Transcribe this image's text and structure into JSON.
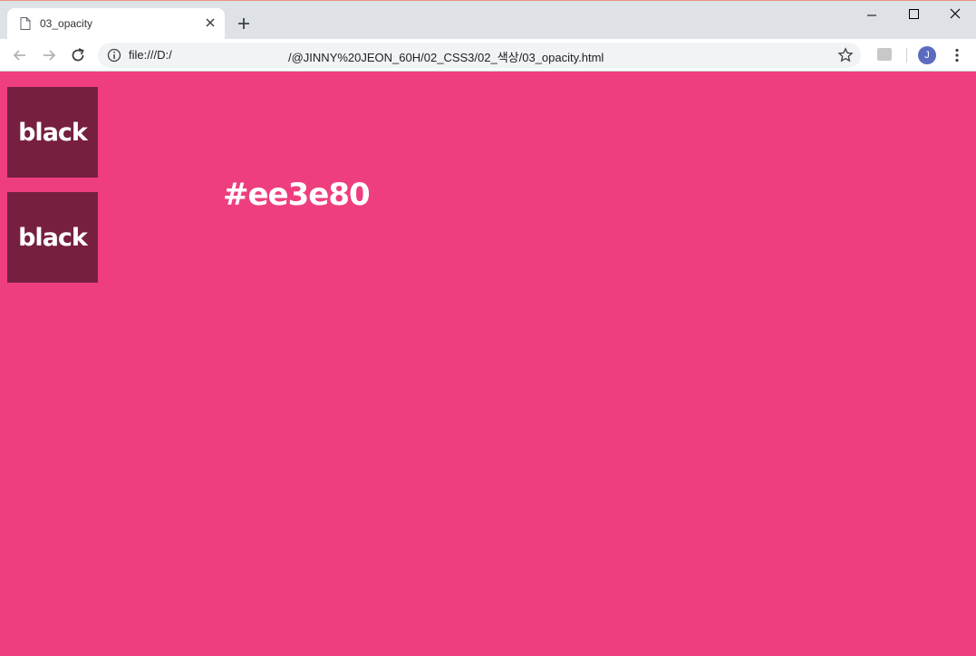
{
  "browser": {
    "tab_title": "03_opacity",
    "url_part1": "file:///D:/",
    "url_part2": "/@JINNY%20JEON_60H/02_CSS3/02_색상/03_opacity.html",
    "profile_initial": "J",
    "extension_label": "ext"
  },
  "page": {
    "background_color": "#ee3e80",
    "boxes": [
      {
        "label": "black"
      },
      {
        "label": "black"
      }
    ],
    "hex_label": "#ee3e80"
  }
}
